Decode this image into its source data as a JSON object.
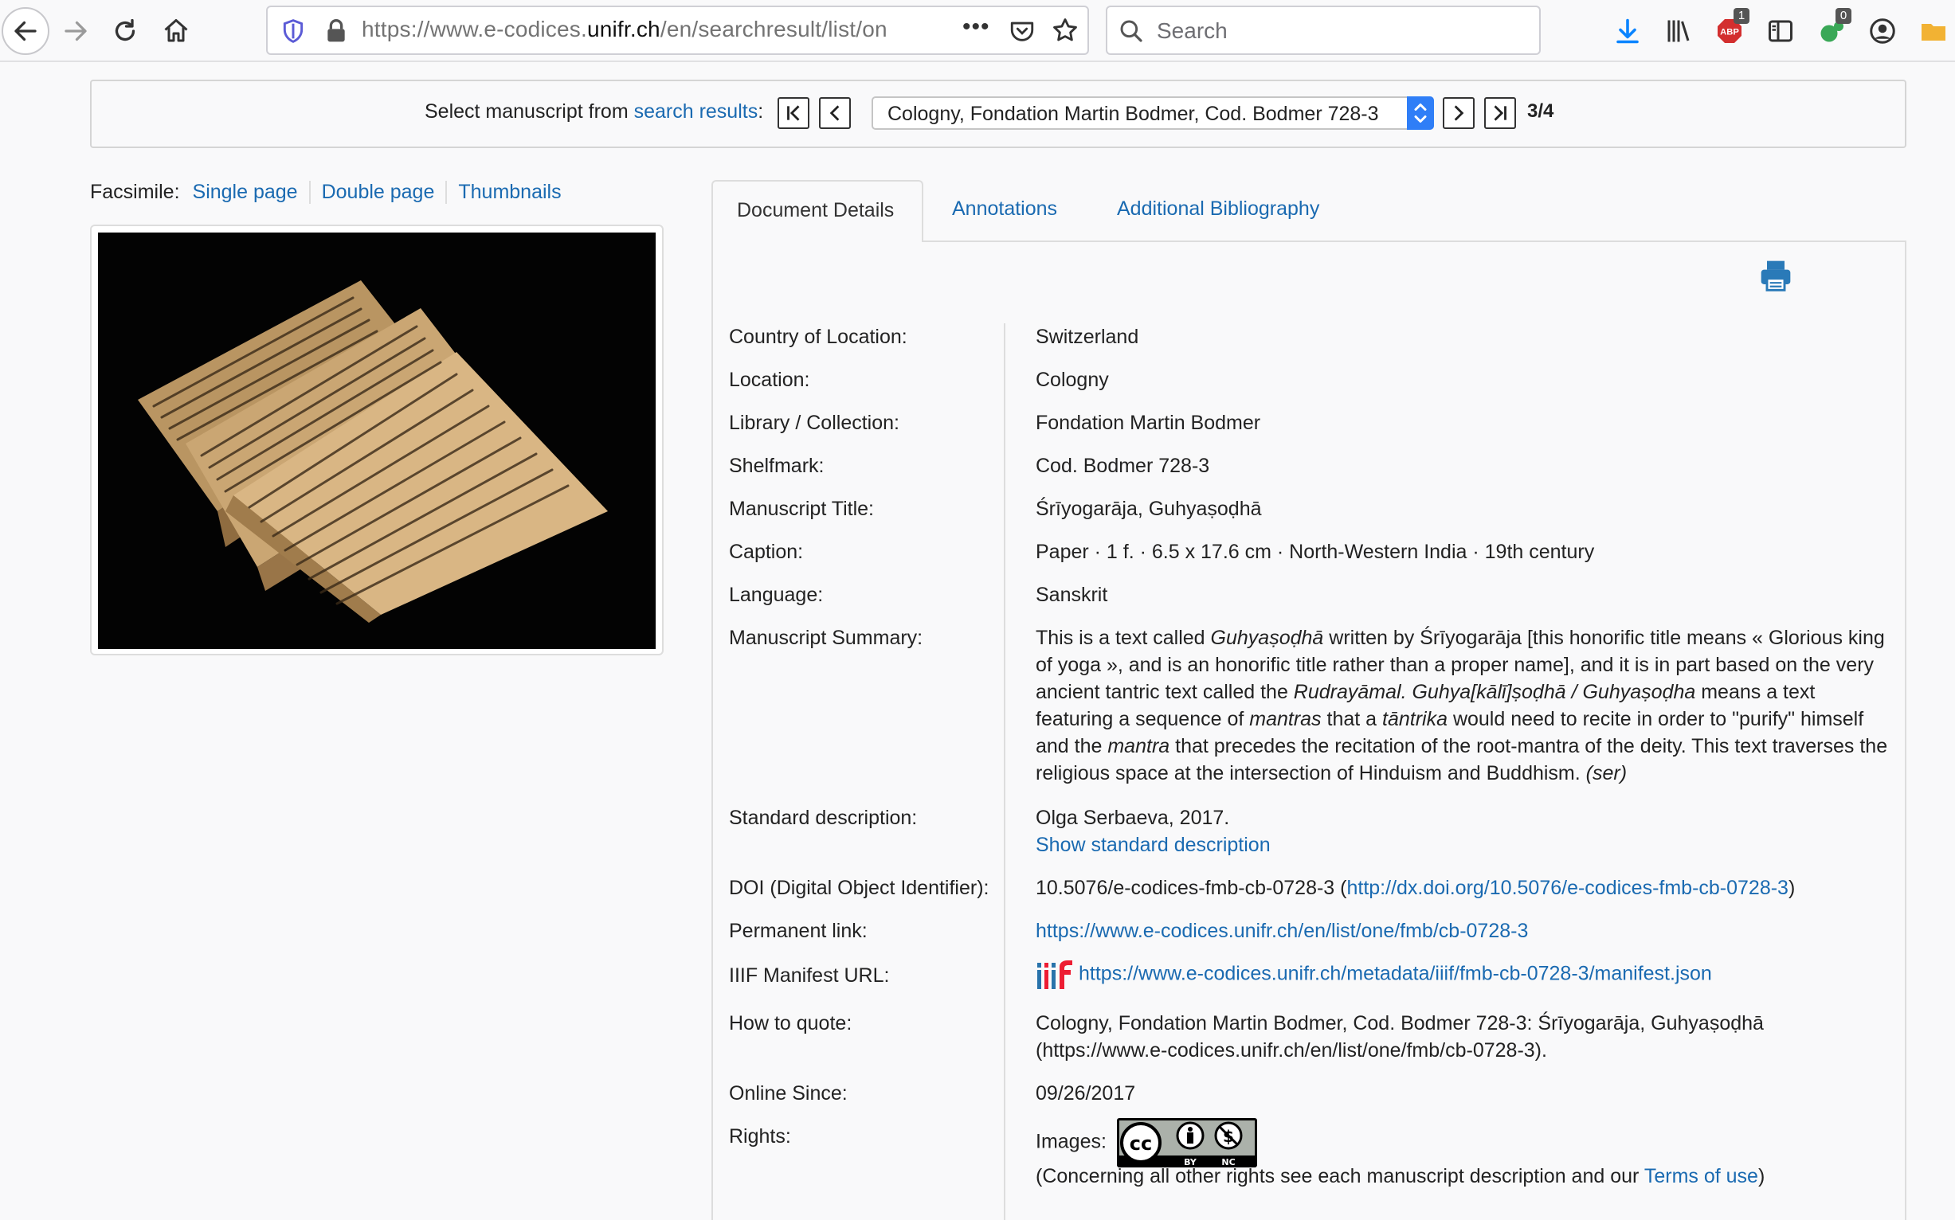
{
  "browser": {
    "url_prefix": "https://www.e-codices.",
    "url_domain": "unifr.ch",
    "url_rest": "/en/searchresult/list/on",
    "more_label": "•••",
    "search_placeholder": "Search",
    "adblock_badge": "1",
    "ext_badge": "0"
  },
  "selector": {
    "label_prefix": "Select manuscript from ",
    "label_link": "search results",
    "label_suffix": ":",
    "selected_manuscript": "Cologny, Fondation Martin Bodmer, Cod. Bodmer 728-3",
    "counter": "3/4"
  },
  "facsimile": {
    "label": "Facsimile:",
    "single_page": "Single page",
    "double_page": "Double page",
    "thumbnails": "Thumbnails"
  },
  "tabs": {
    "details": "Document Details",
    "annotations": "Annotations",
    "bibliography": "Additional Bibliography"
  },
  "details": {
    "country_label": "Country of Location:",
    "country": "Switzerland",
    "location_label": "Location:",
    "location": "Cologny",
    "library_label": "Library / Collection:",
    "library": "Fondation Martin Bodmer",
    "shelfmark_label": "Shelfmark:",
    "shelfmark": "Cod. Bodmer 728-3",
    "title_label": "Manuscript Title:",
    "title": "Śrīyogarāja, Guhyaṣoḍhā",
    "caption_label": "Caption:",
    "caption": "Paper · 1 f. · 6.5 x 17.6 cm · North-Western India · 19th century",
    "language_label": "Language:",
    "language": "Sanskrit",
    "summary_label": "Manuscript Summary:",
    "summary_p1": "This is a text called ",
    "summary_i1": "Guhyaṣoḍhā",
    "summary_p2": " written by Śrīyogarāja [this honorific title means « Glorious king of yoga », and is an honorific title rather than a proper name], and it is in part based on the very ancient tantric text called the ",
    "summary_i2": "Rudrayāmal. Guhya[kālī]ṣoḍhā / Guhyaṣoḍha",
    "summary_p3": " means a text featuring a sequence of ",
    "summary_i3": "mantras",
    "summary_p4": " that a ",
    "summary_i4": "tāntrika",
    "summary_p5": " would need to recite in order to \"purify\" himself and the ",
    "summary_i5": "mantra",
    "summary_p6": " that precedes the recitation of the root-mantra of the deity. This text traverses the religious space at the intersection of Hinduism and Buddhism. ",
    "summary_i6": "(ser)",
    "standard_label": "Standard description:",
    "standard_value": "Olga Serbaeva, 2017.",
    "standard_link": "Show standard description",
    "doi_label": "DOI (Digital Object Identifier):",
    "doi_value": "10.5076/e-codices-fmb-cb-0728-3 (",
    "doi_link": "http://dx.doi.org/10.5076/e-codices-fmb-cb-0728-3",
    "doi_close": ")",
    "permalink_label": "Permanent link:",
    "permalink": "https://www.e-codices.unifr.ch/en/list/one/fmb/cb-0728-3",
    "iiif_label": "IIIF Manifest URL:",
    "iiif_url": "https://www.e-codices.unifr.ch/metadata/iiif/fmb-cb-0728-3/manifest.json",
    "quote_label": "How to quote:",
    "quote": "Cologny, Fondation Martin Bodmer, Cod. Bodmer 728-3: Śrīyogarāja, Guhyaṣoḍhā (https://www.e-codices.unifr.ch/en/list/one/fmb/cb-0728-3).",
    "online_label": "Online Since:",
    "online": "09/26/2017",
    "rights_label": "Rights:",
    "rights_images": "Images:",
    "rights_note_prefix": "(Concerning all other rights see each manuscript description and our ",
    "rights_terms": "Terms of use",
    "rights_note_suffix": ")"
  },
  "colors": {
    "link": "#1a6ab1",
    "select_arrow": "#2f7ef7",
    "print_icon": "#2a7ab8"
  }
}
